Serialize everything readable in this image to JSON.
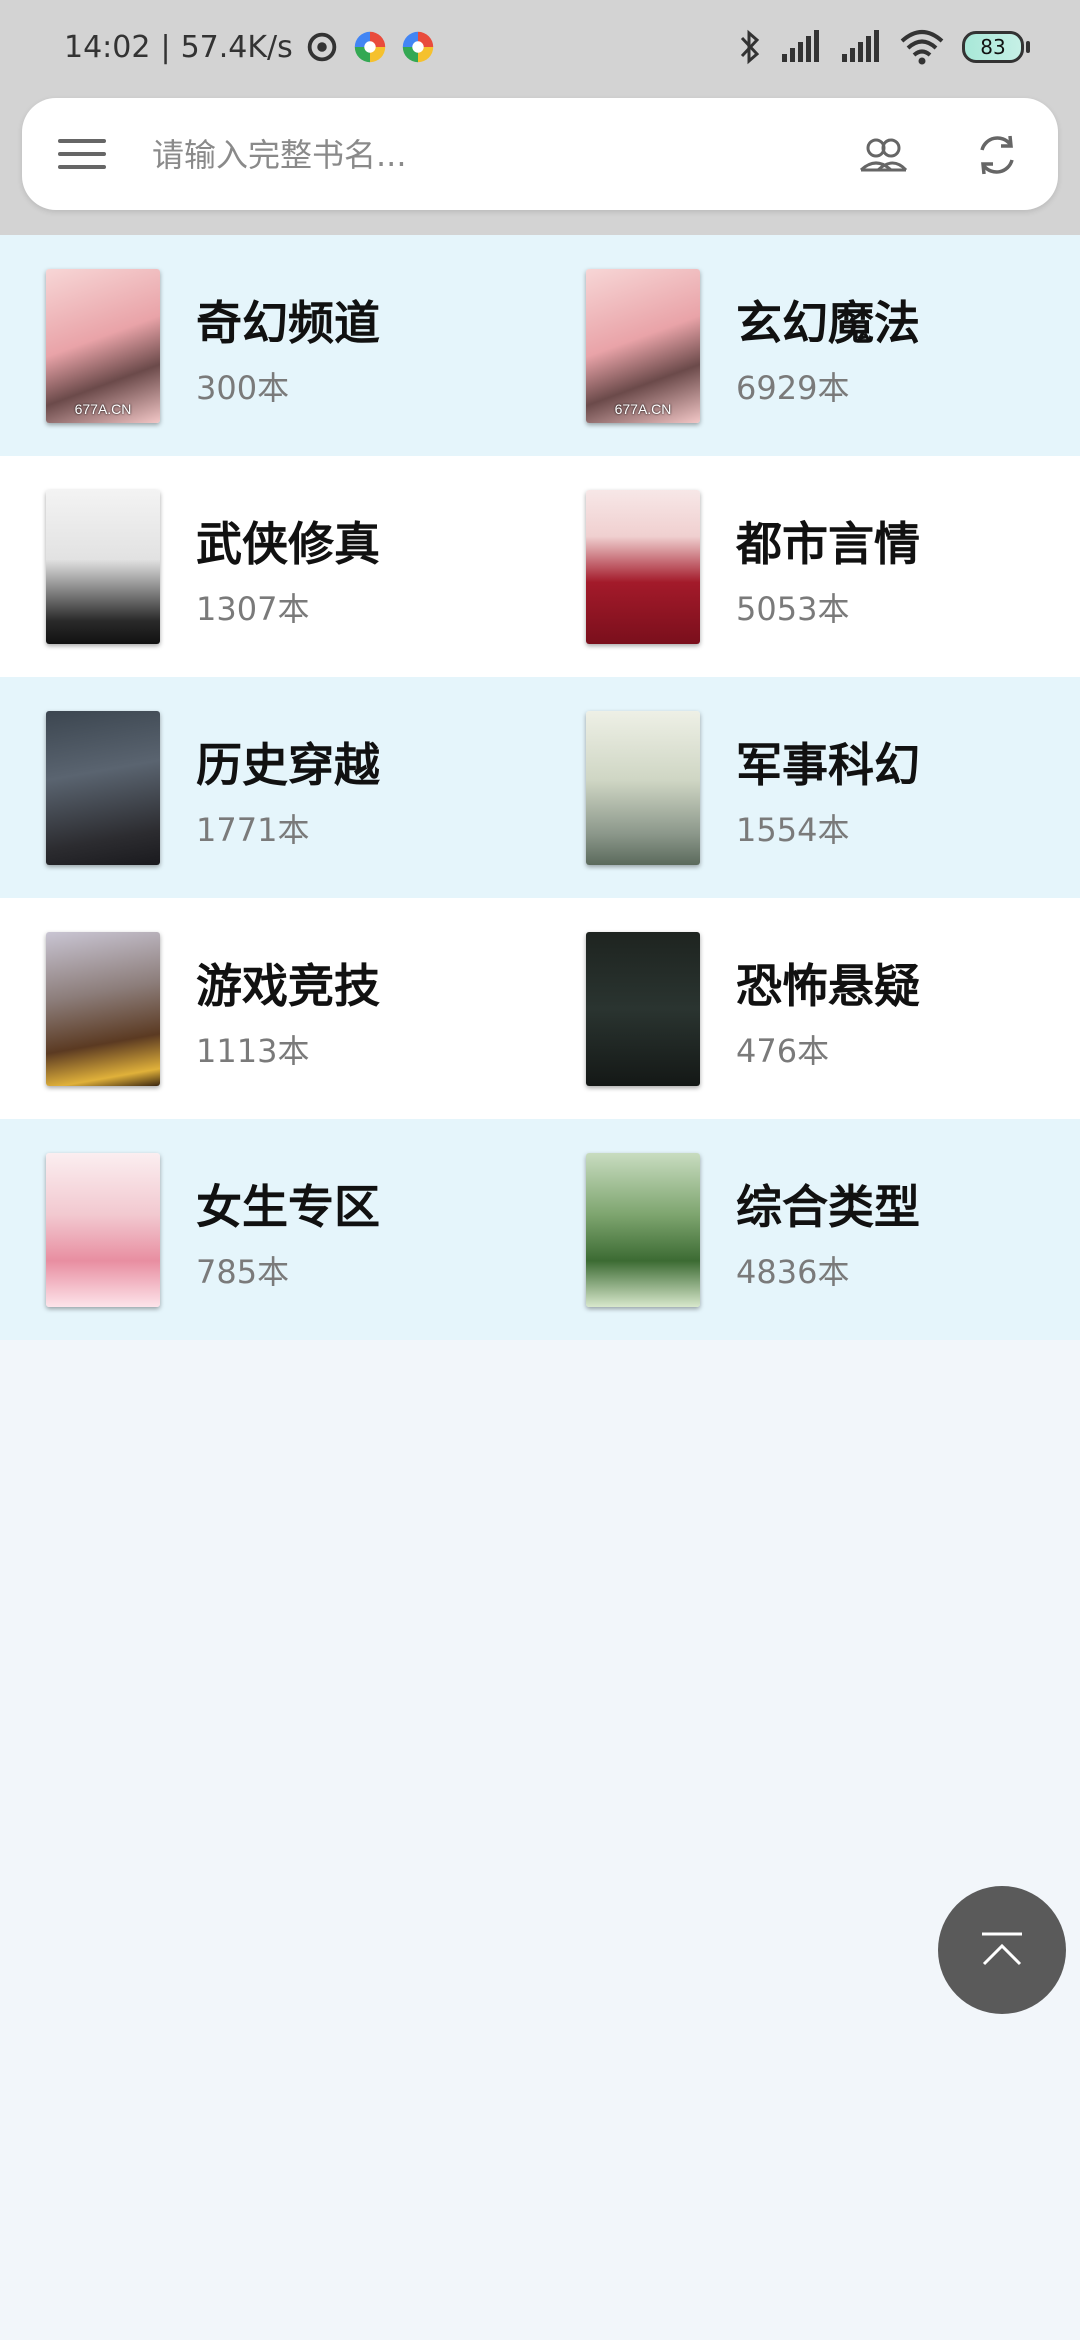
{
  "status": {
    "time": "14:02",
    "speed": "57.4K/s",
    "battery": "83"
  },
  "search": {
    "placeholder": "请输入完整书名..."
  },
  "categories": [
    {
      "title": "奇幻频道",
      "count": "300本",
      "cover_text": "677A.CN"
    },
    {
      "title": "玄幻魔法",
      "count": "6929本",
      "cover_text": "677A.CN"
    },
    {
      "title": "武侠修真",
      "count": "1307本",
      "cover_text": ""
    },
    {
      "title": "都市言情",
      "count": "5053本",
      "cover_text": ""
    },
    {
      "title": "历史穿越",
      "count": "1771本",
      "cover_text": ""
    },
    {
      "title": "军事科幻",
      "count": "1554本",
      "cover_text": ""
    },
    {
      "title": "游戏竞技",
      "count": "1113本",
      "cover_text": ""
    },
    {
      "title": "恐怖悬疑",
      "count": "476本",
      "cover_text": ""
    },
    {
      "title": "女生专区",
      "count": "785本",
      "cover_text": ""
    },
    {
      "title": "综合类型",
      "count": "4836本",
      "cover_text": ""
    }
  ],
  "colors": {
    "tint_row": "#e5f5fb",
    "white_row": "#ffffff",
    "page_bg": "#f2f6fa",
    "fab": "#5a5a5a"
  }
}
